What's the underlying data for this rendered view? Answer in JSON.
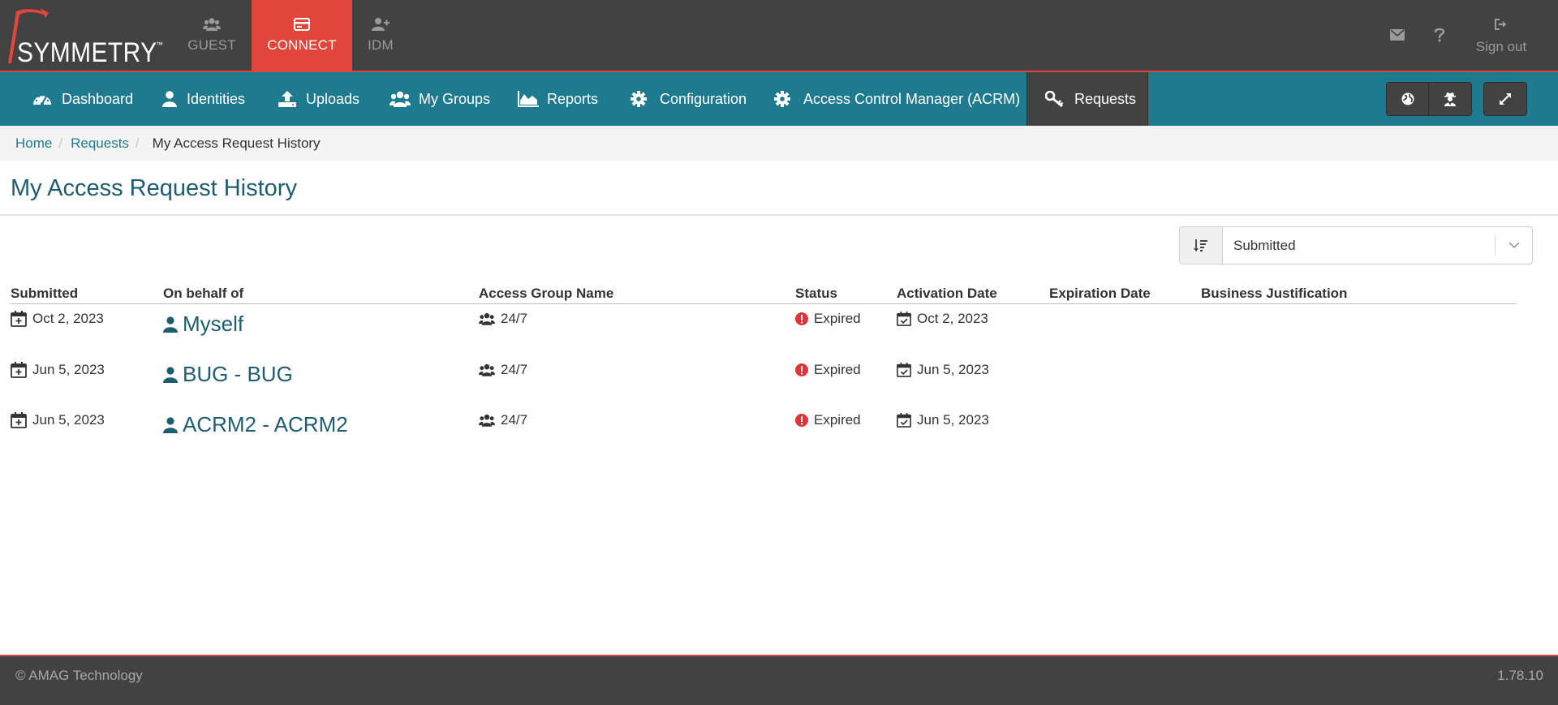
{
  "brand": {
    "logo_text": "SYMMETRY",
    "logo_tm": "™",
    "colors": {
      "topbar": "#424242",
      "accent": "#e0463a",
      "nav": "#1e7a8e",
      "title": "#1e5d70",
      "status_error": "#e0333a"
    }
  },
  "apps": [
    {
      "label": "GUEST",
      "icon": "users-icon",
      "active": false
    },
    {
      "label": "CONNECT",
      "icon": "card-icon",
      "active": true
    },
    {
      "label": "IDM",
      "icon": "user-plus-icon",
      "active": false
    }
  ],
  "topbar_right": {
    "mail_icon": "envelope-icon",
    "help_icon": "question-icon",
    "signout_label": "Sign out"
  },
  "nav": [
    {
      "label": "Dashboard",
      "icon": "dashboard-icon"
    },
    {
      "label": "Identities",
      "icon": "user-icon"
    },
    {
      "label": "Uploads",
      "icon": "upload-icon"
    },
    {
      "label": "My Groups",
      "icon": "users-icon"
    },
    {
      "label": "Reports",
      "icon": "area-chart-icon"
    },
    {
      "label": "Configuration",
      "icon": "gear-icon"
    },
    {
      "label": "Access Control Manager (ACRM)",
      "icon": "gear-icon"
    },
    {
      "label": "Requests",
      "icon": "key-icon",
      "active": true
    }
  ],
  "nav_buttons": [
    "globe-icon",
    "user-secret-icon",
    "expand-icon"
  ],
  "breadcrumb": {
    "home": "Home",
    "requests": "Requests",
    "current": "My Access Request History",
    "sep": "/"
  },
  "page": {
    "title": "My Access Request History"
  },
  "sort": {
    "value": "Submitted",
    "icon": "sort-icon"
  },
  "table": {
    "columns": [
      "Submitted",
      "On behalf of",
      "Access Group Name",
      "Status",
      "Activation Date",
      "Expiration Date",
      "Business Justification"
    ],
    "rows": [
      {
        "submitted": "Oct 2, 2023",
        "on_behalf_of": "Myself",
        "group": "24/7",
        "status": "Expired",
        "activation": "Oct 2, 2023",
        "expiration": "",
        "justification": ""
      },
      {
        "submitted": "Jun 5, 2023",
        "on_behalf_of": "BUG - BUG",
        "group": "24/7",
        "status": "Expired",
        "activation": "Jun 5, 2023",
        "expiration": "",
        "justification": ""
      },
      {
        "submitted": "Jun 5, 2023",
        "on_behalf_of": "ACRM2 - ACRM2",
        "group": "24/7",
        "status": "Expired",
        "activation": "Jun 5, 2023",
        "expiration": "",
        "justification": ""
      }
    ]
  },
  "footer": {
    "copyright": "© AMAG Technology",
    "version": "1.78.10"
  }
}
